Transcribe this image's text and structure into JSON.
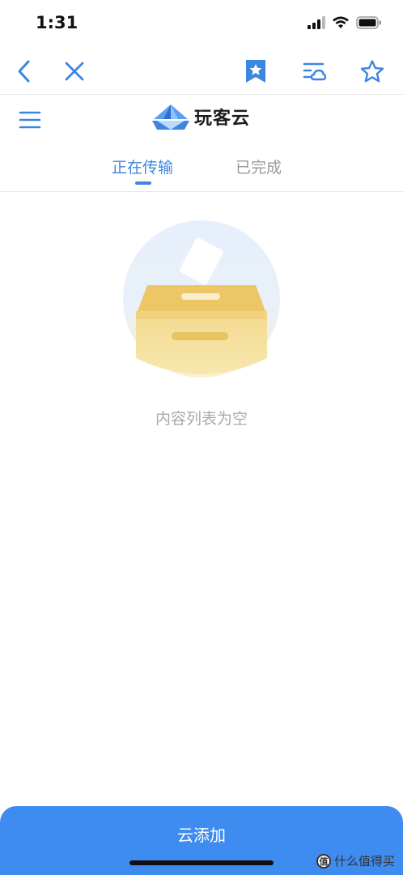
{
  "status_bar": {
    "time": "1:31"
  },
  "nav": {
    "back_icon": "chevron-left-icon",
    "close_icon": "close-icon",
    "bookmark_icon": "bookmark-star-icon",
    "cloud_list_icon": "cloud-list-icon",
    "favorite_icon": "star-outline-icon"
  },
  "header": {
    "brand_name": "玩客云"
  },
  "tabs": [
    {
      "label": "正在传输",
      "active": true
    },
    {
      "label": "已完成",
      "active": false
    }
  ],
  "empty_state": {
    "message": "内容列表为空"
  },
  "bottom_action": {
    "label": "云添加"
  },
  "watermark": {
    "logo_text": "值",
    "text": "什么值得买"
  },
  "colors": {
    "accent": "#3d86e0",
    "button": "#3f8cf0",
    "muted": "#a8a8a8",
    "box": "#f3d27a"
  }
}
